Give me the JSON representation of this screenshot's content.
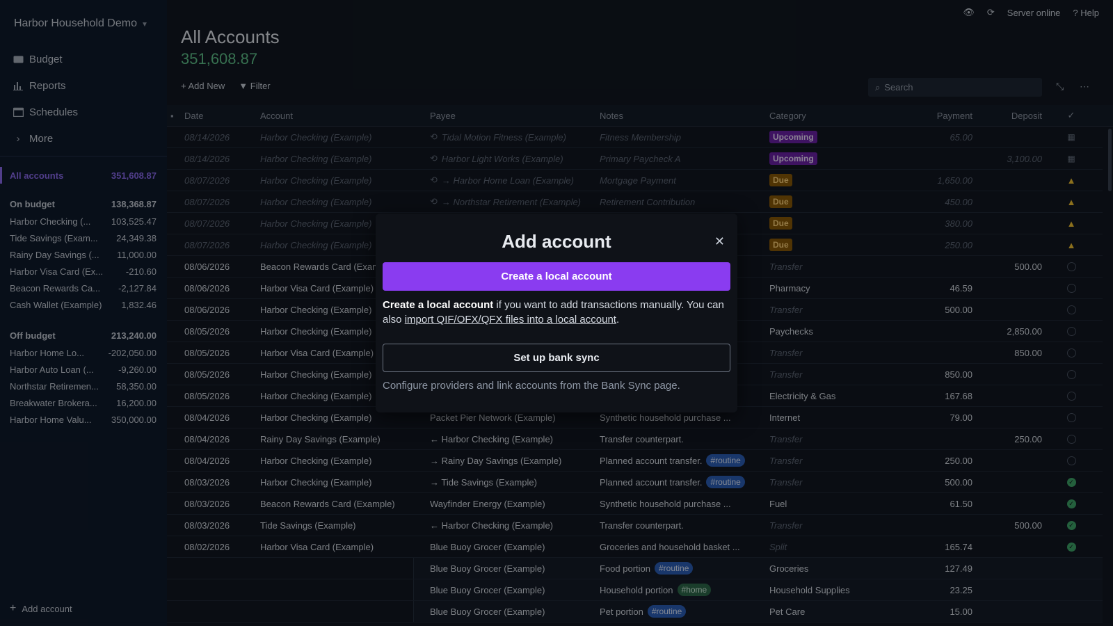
{
  "sidebar": {
    "budget_name": "Harbor Household Demo",
    "nav": [
      "Budget",
      "Reports",
      "Schedules",
      "More"
    ],
    "all_accounts": {
      "label": "All accounts",
      "balance": "351,608.87"
    },
    "on_budget": {
      "label": "On budget",
      "balance": "138,368.87",
      "accounts": [
        {
          "name": "Harbor Checking (...",
          "balance": "103,525.47"
        },
        {
          "name": "Tide Savings (Exam...",
          "balance": "24,349.38"
        },
        {
          "name": "Rainy Day Savings (...",
          "balance": "11,000.00"
        },
        {
          "name": "Harbor Visa Card (Ex...",
          "balance": "-210.60"
        },
        {
          "name": "Beacon Rewards Ca...",
          "balance": "-2,127.84"
        },
        {
          "name": "Cash Wallet (Example)",
          "balance": "1,832.46"
        }
      ]
    },
    "off_budget": {
      "label": "Off budget",
      "balance": "213,240.00",
      "accounts": [
        {
          "name": "Harbor Home Lo...",
          "balance": "-202,050.00"
        },
        {
          "name": "Harbor Auto Loan (...",
          "balance": "-9,260.00"
        },
        {
          "name": "Northstar Retiremen...",
          "balance": "58,350.00"
        },
        {
          "name": "Breakwater Brokera...",
          "balance": "16,200.00"
        },
        {
          "name": "Harbor Home Valu...",
          "balance": "350,000.00"
        }
      ]
    },
    "add_account": "Add account"
  },
  "topbar": {
    "server_status": "Server online",
    "help": "Help"
  },
  "header": {
    "title": "All Accounts",
    "balance": "351,608.87",
    "add_new": "Add New",
    "filter": "Filter",
    "search_placeholder": "Search"
  },
  "table": {
    "columns": {
      "date": "Date",
      "account": "Account",
      "payee": "Payee",
      "notes": "Notes",
      "category": "Category",
      "payment": "Payment",
      "deposit": "Deposit",
      "cleared": "✓"
    },
    "rows": [
      {
        "date": "08/14/2026",
        "account": "Harbor Checking (Example)",
        "payee": "Tidal Motion Fitness (Example)",
        "notes": "Fitness Membership",
        "category": "Upcoming",
        "payment": "65.00",
        "deposit": "",
        "status": "cal"
      },
      {
        "date": "08/14/2026",
        "account": "Harbor Checking (Example)",
        "payee": "Harbor Light Works (Example)",
        "notes": "Primary Paycheck A",
        "category": "Upcoming",
        "payment": "",
        "deposit": "3,100.00",
        "status": "cal"
      },
      {
        "date": "08/07/2026",
        "account": "Harbor Checking (Example)",
        "payee": "→ Harbor Home Loan (Example)",
        "notes": "Mortgage Payment",
        "category": "Due",
        "payment": "1,650.00",
        "deposit": "",
        "status": "warn"
      },
      {
        "date": "08/07/2026",
        "account": "Harbor Checking (Example)",
        "payee": "→ Northstar Retirement (Example)",
        "notes": "Retirement Contribution",
        "category": "Due",
        "payment": "450.00",
        "deposit": "",
        "status": "warn"
      },
      {
        "date": "08/07/2026",
        "account": "Harbor Checking (Example)",
        "payee": "",
        "notes": "",
        "category": "Due",
        "payment": "380.00",
        "deposit": "",
        "status": "warn"
      },
      {
        "date": "08/07/2026",
        "account": "Harbor Checking (Example)",
        "payee": "",
        "notes": "",
        "category": "Due",
        "payment": "250.00",
        "deposit": "",
        "status": "warn"
      },
      {
        "date": "08/06/2026",
        "account": "Beacon Rewards Card (Example)",
        "payee": "",
        "notes": "",
        "category": "Transfer",
        "payment": "",
        "deposit": "500.00",
        "status": "open"
      },
      {
        "date": "08/06/2026",
        "account": "Harbor Visa Card (Example)",
        "payee": "",
        "notes": "",
        "category": "Pharmacy",
        "payment": "46.59",
        "deposit": "",
        "status": "open"
      },
      {
        "date": "08/06/2026",
        "account": "Harbor Checking (Example)",
        "payee": "",
        "notes": "",
        "category": "Transfer",
        "payment": "500.00",
        "deposit": "",
        "status": "open"
      },
      {
        "date": "08/05/2026",
        "account": "Harbor Checking (Example)",
        "payee": "",
        "notes": "",
        "category": "Paychecks",
        "payment": "",
        "deposit": "2,850.00",
        "status": "open"
      },
      {
        "date": "08/05/2026",
        "account": "Harbor Visa Card (Example)",
        "payee": "",
        "notes": "",
        "category": "Transfer",
        "payment": "",
        "deposit": "850.00",
        "status": "open"
      },
      {
        "date": "08/05/2026",
        "account": "Harbor Checking (Example)",
        "payee": "",
        "notes": "",
        "category": "Transfer",
        "payment": "850.00",
        "deposit": "",
        "status": "open"
      },
      {
        "date": "08/05/2026",
        "account": "Harbor Checking (Example)",
        "payee": "",
        "notes": "",
        "category": "Electricity & Gas",
        "payment": "167.68",
        "deposit": "",
        "status": "open"
      },
      {
        "date": "08/04/2026",
        "account": "Harbor Checking (Example)",
        "payee": "Packet Pier Network (Example)",
        "notes": "Synthetic household purchase ...",
        "category": "Internet",
        "payment": "79.00",
        "deposit": "",
        "status": "open"
      },
      {
        "date": "08/04/2026",
        "account": "Rainy Day Savings (Example)",
        "payee": "← Harbor Checking (Example)",
        "notes": "Transfer counterpart.",
        "category": "Transfer",
        "payment": "",
        "deposit": "250.00",
        "status": "open"
      },
      {
        "date": "08/04/2026",
        "account": "Harbor Checking (Example)",
        "payee": "→ Rainy Day Savings (Example)",
        "notes": "Planned account transfer.",
        "tag": "#routine",
        "category": "Transfer",
        "payment": "250.00",
        "deposit": "",
        "status": "open"
      },
      {
        "date": "08/03/2026",
        "account": "Harbor Checking (Example)",
        "payee": "→ Tide Savings (Example)",
        "notes": "Planned account transfer.",
        "tag": "#routine",
        "category": "Transfer",
        "payment": "500.00",
        "deposit": "",
        "status": "done"
      },
      {
        "date": "08/03/2026",
        "account": "Beacon Rewards Card (Example)",
        "payee": "Wayfinder Energy (Example)",
        "notes": "Synthetic household purchase ...",
        "category": "Fuel",
        "payment": "61.50",
        "deposit": "",
        "status": "done"
      },
      {
        "date": "08/03/2026",
        "account": "Tide Savings (Example)",
        "payee": "← Harbor Checking (Example)",
        "notes": "Transfer counterpart.",
        "category": "Transfer",
        "payment": "",
        "deposit": "500.00",
        "status": "done"
      },
      {
        "date": "08/02/2026",
        "account": "Harbor Visa Card (Example)",
        "payee": "Blue Buoy Grocer (Example)",
        "notes": "Groceries and household basket ...",
        "category": "Split",
        "payment": "165.74",
        "deposit": "",
        "status": "done"
      }
    ],
    "split_rows": [
      {
        "payee": "Blue Buoy Grocer (Example)",
        "notes": "Food portion",
        "tag": "#routine",
        "category": "Groceries",
        "payment": "127.49"
      },
      {
        "payee": "Blue Buoy Grocer (Example)",
        "notes": "Household portion",
        "tag": "#home",
        "category": "Household Supplies",
        "payment": "23.25"
      },
      {
        "payee": "Blue Buoy Grocer (Example)",
        "notes": "Pet portion",
        "tag": "#routine",
        "category": "Pet Care",
        "payment": "15.00"
      }
    ]
  },
  "modal": {
    "title": "Add account",
    "create_local": "Create a local account",
    "desc_bold": "Create a local account",
    "desc_rest": " if you want to add transactions manually. You can also ",
    "desc_link": "import QIF/OFX/QFX files into a local account",
    "desc_end": ".",
    "bank_sync": "Set up bank sync",
    "bank_sync_help": "Configure providers and link accounts from the Bank Sync page."
  },
  "colors": {
    "accent": "#8a3cf0",
    "positive": "#5fc28b",
    "upcoming": "#6b22a8",
    "due": "#8a5a08"
  }
}
